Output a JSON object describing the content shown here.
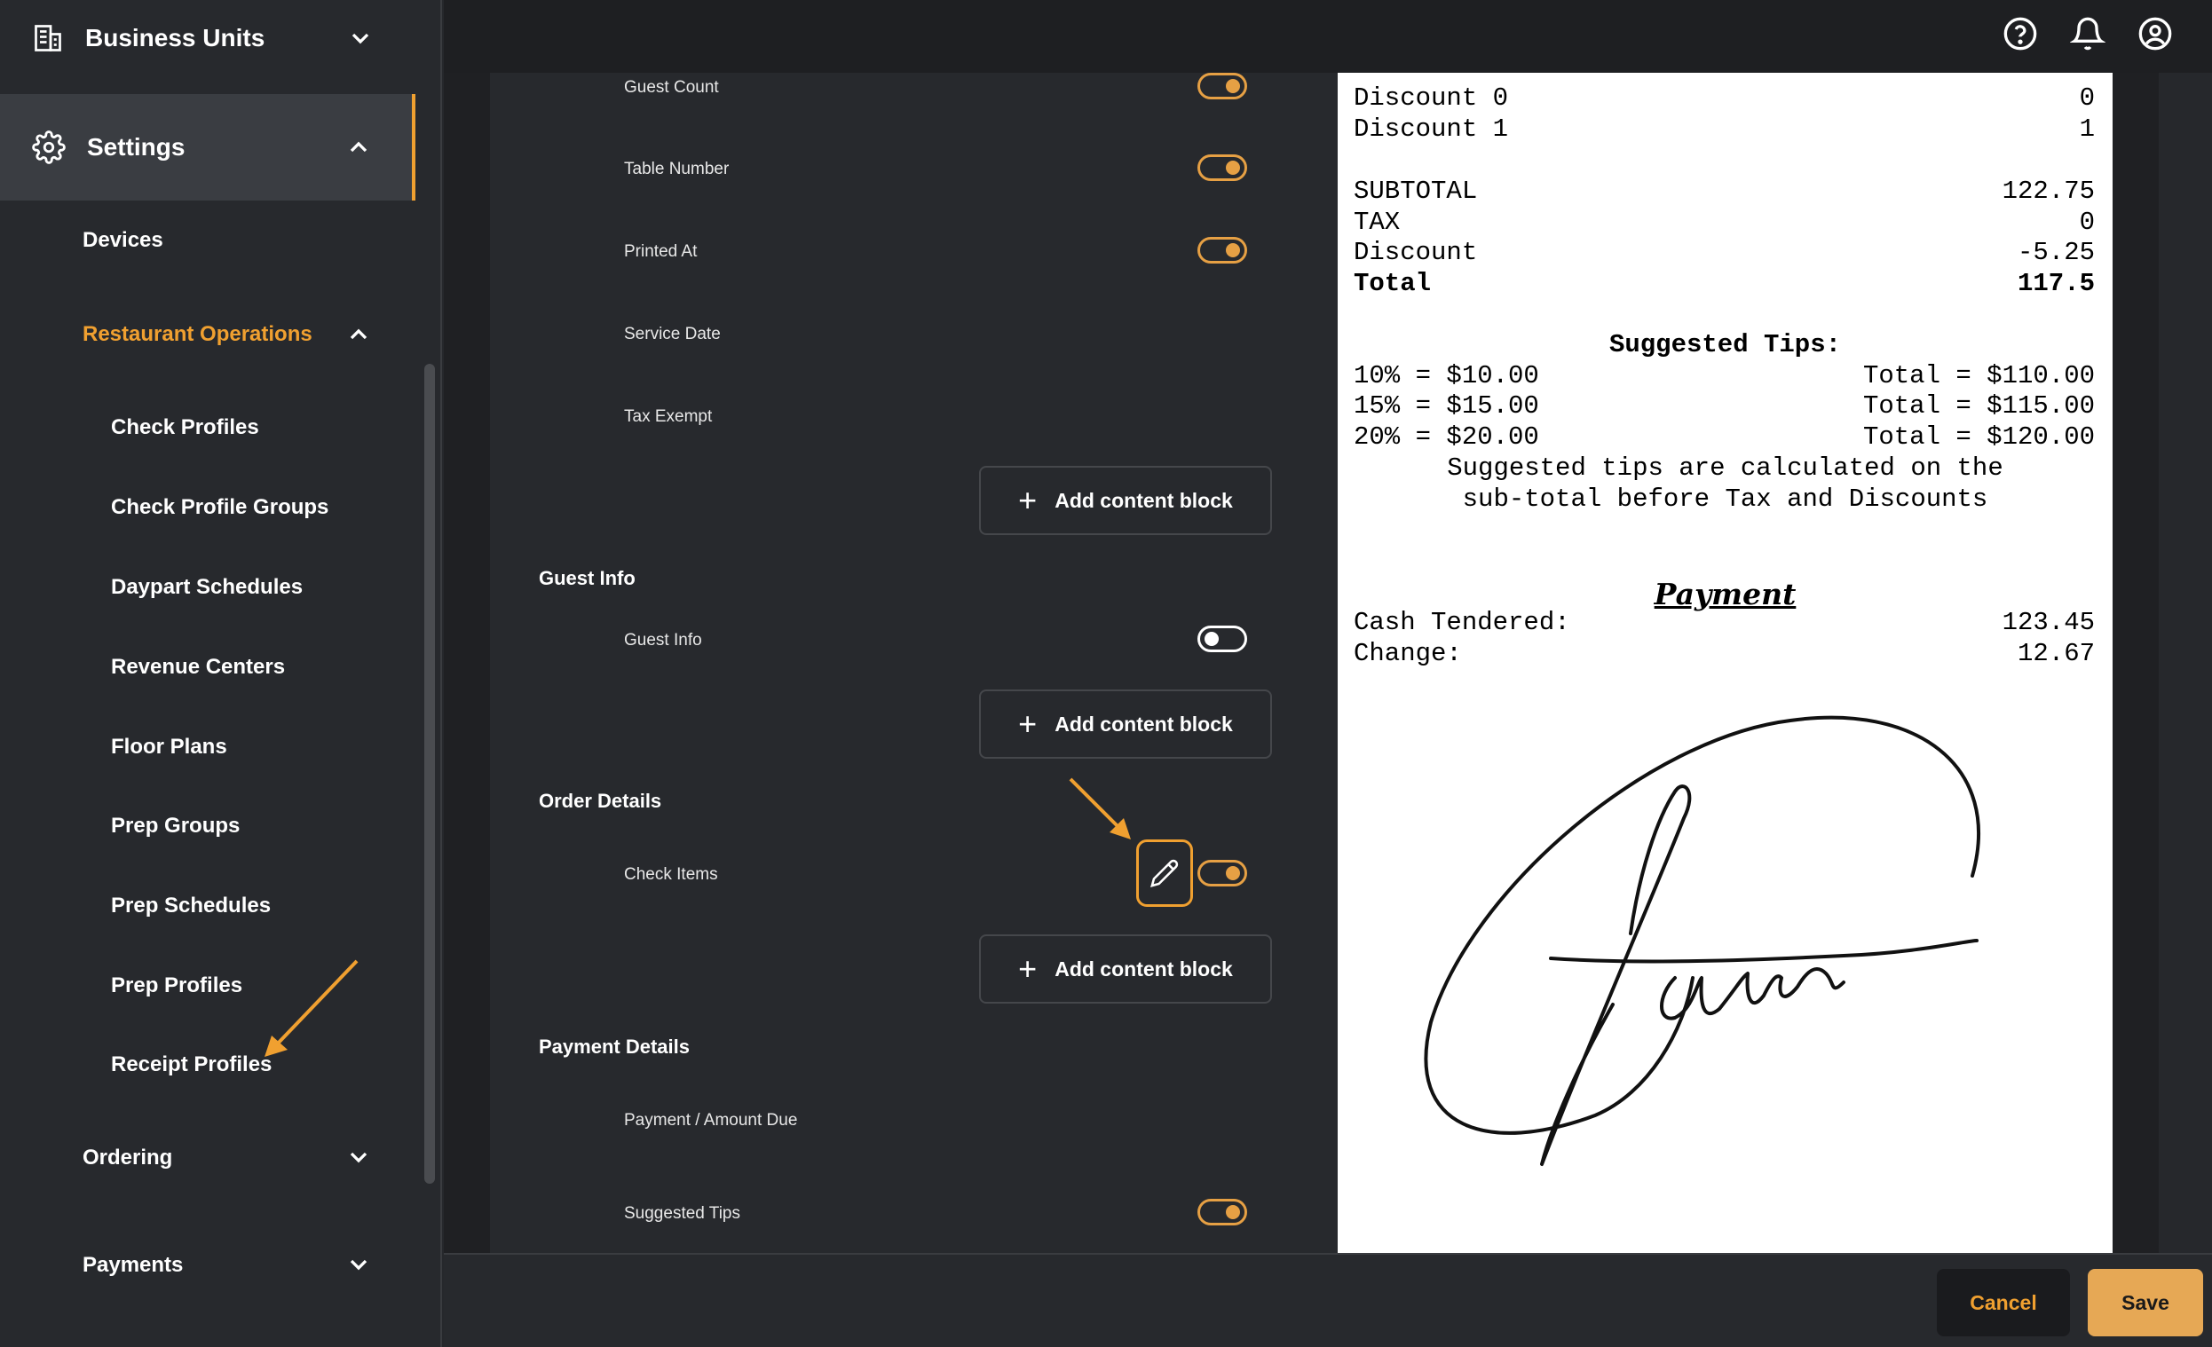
{
  "sidebar": {
    "business_units": "Business Units",
    "settings": "Settings",
    "devices": "Devices",
    "restaurant_operations": "Restaurant Operations",
    "sub_items": [
      "Check Profiles",
      "Check Profile Groups",
      "Daypart Schedules",
      "Revenue Centers",
      "Floor Plans",
      "Prep Groups",
      "Prep Schedules",
      "Prep Profiles",
      "Receipt Profiles"
    ],
    "ordering": "Ordering",
    "payments": "Payments"
  },
  "topbar": {
    "icons": [
      "help-icon",
      "bell-icon",
      "user-icon"
    ]
  },
  "form": {
    "rows": {
      "guest_count": {
        "label": "Guest Count",
        "toggle": true
      },
      "table_number": {
        "label": "Table Number",
        "toggle": true
      },
      "printed_at": {
        "label": "Printed At",
        "toggle": true
      },
      "service_date": {
        "label": "Service Date"
      },
      "tax_exempt": {
        "label": "Tax Exempt"
      },
      "guest_info": {
        "label": "Guest Info",
        "toggle": false
      },
      "check_items": {
        "label": "Check Items",
        "toggle": true
      },
      "payment_amount_due": {
        "label": "Payment / Amount Due"
      },
      "suggested_tips": {
        "label": "Suggested Tips",
        "toggle": true
      }
    },
    "sections": {
      "guest_info": "Guest Info",
      "order_details": "Order Details",
      "payment_details": "Payment Details"
    },
    "add_block_label": "Add content block"
  },
  "receipt": {
    "discount0": {
      "label": "Discount 0",
      "value": "0"
    },
    "discount1": {
      "label": "Discount 1",
      "value": "1"
    },
    "subtotal": {
      "label": "SUBTOTAL",
      "value": "122.75"
    },
    "tax": {
      "label": "TAX",
      "value": "0"
    },
    "discount": {
      "label": "Discount",
      "value": "-5.25"
    },
    "total": {
      "label": "Total",
      "value": "117.5"
    },
    "tips_title": "Suggested Tips:",
    "tips": [
      {
        "left": "10% = $10.00",
        "right": "Total = $110.00"
      },
      {
        "left": "15% = $15.00",
        "right": "Total = $115.00"
      },
      {
        "left": "20% = $20.00",
        "right": "Total = $120.00"
      }
    ],
    "tips_note_1": "Suggested tips are calculated on the",
    "tips_note_2": "sub-total before Tax and Discounts",
    "payment_title": "Payment",
    "cash_tendered": {
      "label": "Cash Tendered:",
      "value": "123.45"
    },
    "change": {
      "label": "Change:",
      "value": "12.67"
    }
  },
  "footer": {
    "cancel": "Cancel",
    "save": "Save"
  },
  "colors": {
    "accent": "#f0a030",
    "save_bg": "#e6a855"
  }
}
